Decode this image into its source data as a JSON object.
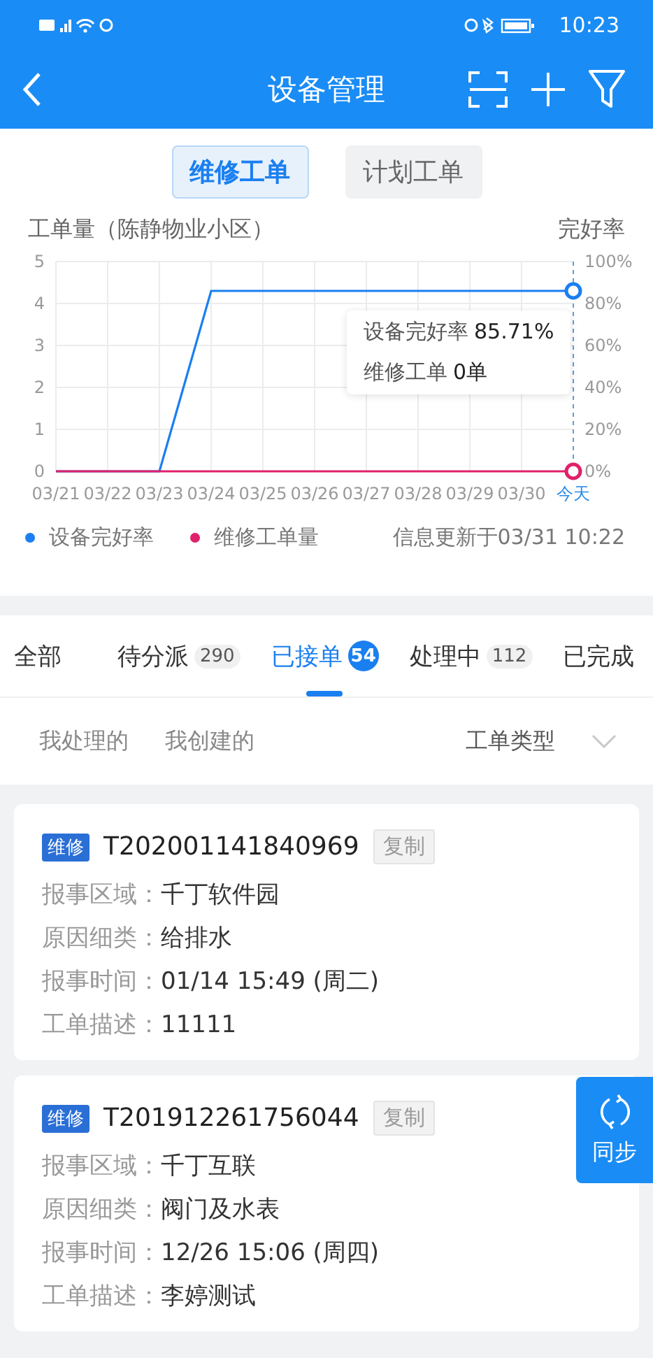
{
  "status_bar": {
    "time": "10:23"
  },
  "header": {
    "title": "设备管理"
  },
  "toggle": [
    {
      "label": "维修工单",
      "selected": true
    },
    {
      "label": "计划工单",
      "selected": false
    }
  ],
  "chart": {
    "chart_data": {
      "type": "line",
      "ylabel": "工单量（陈静物业小区）",
      "y2label": "完好率",
      "categories": [
        "03/21",
        "03/22",
        "03/23",
        "03/24",
        "03/25",
        "03/26",
        "03/27",
        "03/28",
        "03/29",
        "03/30",
        "今天"
      ],
      "series": [
        {
          "name": "设备完好率",
          "color": "#1a7ff0",
          "axis": "y2",
          "values": [
            0,
            0,
            0,
            86,
            86,
            86,
            86,
            86,
            86,
            86,
            86
          ]
        },
        {
          "name": "维修工单量",
          "color": "#e0206a",
          "values": [
            0,
            0,
            0,
            0,
            0,
            0,
            0,
            0,
            0,
            0,
            0
          ]
        }
      ],
      "grid": true,
      "ylim": [
        0,
        5
      ],
      "yticks": [
        0,
        1,
        2,
        3,
        4,
        5
      ],
      "y2lim": [
        0,
        100
      ],
      "y2ticks": [
        {
          "value": 0,
          "label": "0%"
        },
        {
          "value": 20,
          "label": "20%"
        },
        {
          "value": 40,
          "label": "40%"
        },
        {
          "value": 60,
          "label": "60%"
        },
        {
          "value": 80,
          "label": "80%"
        },
        {
          "value": 100,
          "label": "100%"
        }
      ]
    },
    "tooltip": [
      {
        "label": "设备完好率",
        "value": "85.71%"
      },
      {
        "label": "维修工单",
        "value": "0单"
      }
    ],
    "updated": "信息更新于03/31 10:22"
  },
  "tabs": [
    {
      "label": "全部",
      "selected": false
    },
    {
      "label": "待分派",
      "count": "290",
      "selected": false
    },
    {
      "label": "已接单",
      "count": "54",
      "selected": true
    },
    {
      "label": "处理中",
      "count": "112",
      "selected": false
    },
    {
      "label": "已完成",
      "selected": false
    }
  ],
  "filters": [
    {
      "label": "我处理的"
    },
    {
      "label": "我创建的"
    }
  ],
  "type_filter": "工单类型",
  "orders": [
    {
      "tag": "维修",
      "number": "T202001141840969",
      "copy": "复制",
      "fields": [
        {
          "label": "报事区域：",
          "value": "千丁软件园"
        },
        {
          "label": "原因细类：",
          "value": "给排水"
        },
        {
          "label": "报事时间：",
          "value": "01/14 15:49 (周二)"
        },
        {
          "label": "工单描述：",
          "value": "11111"
        }
      ]
    },
    {
      "tag": "维修",
      "number": "T201912261756044",
      "copy": "复制",
      "fields": [
        {
          "label": "报事区域：",
          "value": "千丁互联"
        },
        {
          "label": "原因细类：",
          "value": "阀门及水表"
        },
        {
          "label": "报事时间：",
          "value": "12/26 15:06 (周四)"
        },
        {
          "label": "工单描述：",
          "value": "李婷测试"
        }
      ]
    }
  ],
  "sync_button": "同步"
}
